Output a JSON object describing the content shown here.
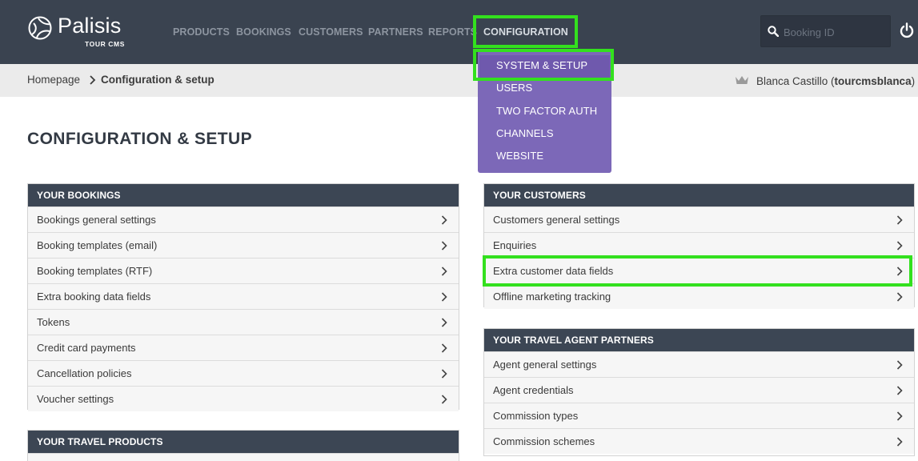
{
  "brand": {
    "name": "Palisis",
    "sub": "TOUR CMS"
  },
  "nav": {
    "items": [
      {
        "label": "PRODUCTS"
      },
      {
        "label": "BOOKINGS"
      },
      {
        "label": "CUSTOMERS"
      },
      {
        "label": "PARTNERS"
      },
      {
        "label": "REPORTS"
      },
      {
        "label": "CONFIGURATION"
      }
    ]
  },
  "search": {
    "placeholder": "Booking ID",
    "value": ""
  },
  "dropdown": {
    "items": [
      {
        "label": "SYSTEM & SETUP"
      },
      {
        "label": "USERS"
      },
      {
        "label": "TWO FACTOR AUTH"
      },
      {
        "label": "CHANNELS"
      },
      {
        "label": "WEBSITE"
      }
    ]
  },
  "breadcrumb": {
    "home": "Homepage",
    "current": "Configuration & setup"
  },
  "user": {
    "name": "Blanca Castillo",
    "username": "tourcmsblanca"
  },
  "page": {
    "title": "CONFIGURATION & SETUP"
  },
  "panels": {
    "bookings": {
      "title": "YOUR BOOKINGS",
      "rows": [
        "Bookings general settings",
        "Booking templates (email)",
        "Booking templates (RTF)",
        "Extra booking data fields",
        "Tokens",
        "Credit card payments",
        "Cancellation policies",
        "Voucher settings"
      ]
    },
    "customers": {
      "title": "YOUR CUSTOMERS",
      "rows": [
        "Customers general settings",
        "Enquiries",
        "Extra customer data fields",
        "Offline marketing tracking"
      ]
    },
    "agents": {
      "title": "YOUR TRAVEL AGENT PARTNERS",
      "rows": [
        "Agent general settings",
        "Agent credentials",
        "Commission types",
        "Commission schemes"
      ]
    },
    "products": {
      "title": "YOUR TRAVEL PRODUCTS",
      "rows": [
        ""
      ]
    }
  },
  "colors": {
    "topbar": "#3a4350",
    "dropdown": "#7c68b8",
    "highlight": "#33e01e",
    "panel_header": "#3c4654"
  }
}
